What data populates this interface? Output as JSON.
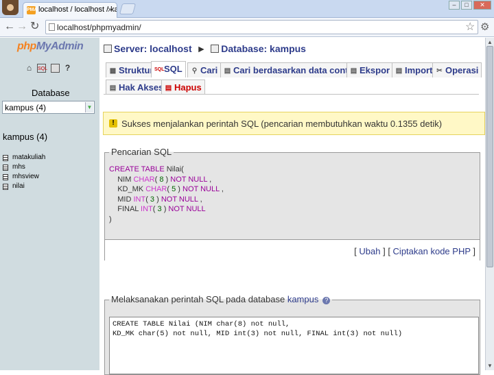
{
  "browser": {
    "tabs": [
      {
        "favicon": "PMA",
        "title": "localhost / localhost / kampus"
      },
      {
        "favicon": "",
        "title": ""
      }
    ],
    "nav": {
      "back": "←",
      "forward": "→",
      "reload": "↻"
    },
    "url": "localhost/phpmyadmin/",
    "window_controls": [
      "–",
      "□",
      "✕"
    ]
  },
  "sidebar": {
    "logo_php": "php",
    "logo_myadmin": "MyAdmin",
    "icons": [
      "home-icon",
      "sql-icon",
      "query-window-icon",
      "docs-icon"
    ],
    "database_label": "Database",
    "database_select_value": "kampus (4)",
    "database_heading": "kampus (4)",
    "tables": [
      "matakuliah",
      "mhs",
      "mhsview",
      "nilai"
    ]
  },
  "main": {
    "breadcrumb": {
      "server": "Server: localhost",
      "separator": "►",
      "database": "Database: kampus"
    },
    "tabs_row1": [
      {
        "label": "Struktur",
        "icon": "structure-icon"
      },
      {
        "label": "SQL",
        "icon": "sql-icon",
        "active": true
      },
      {
        "label": "Cari",
        "icon": "search-icon"
      },
      {
        "label": "Cari berdasarkan data contoh",
        "icon": "query-icon"
      },
      {
        "label": "Ekspor",
        "icon": "export-icon"
      },
      {
        "label": "Import",
        "icon": "import-icon"
      },
      {
        "label": "Operasi",
        "icon": "operations-icon"
      }
    ],
    "tabs_row2": [
      {
        "label": "Hak Akses",
        "icon": "privileges-icon"
      },
      {
        "label": "Hapus",
        "icon": "drop-icon"
      }
    ],
    "notice": "Sukses menjalankan perintah SQL (pencarian membutuhkan waktu 0.1355 detik)",
    "sql_query_box": {
      "legend": "Pencarian SQL",
      "lines": [
        [
          {
            "t": "CREATE TABLE ",
            "c": "kw"
          },
          {
            "t": "Nilai(",
            "c": "plain"
          }
        ],
        [
          {
            "t": "    NIM ",
            "c": "plain"
          },
          {
            "t": "CHAR",
            "c": "fn"
          },
          {
            "t": "( ",
            "c": "plain"
          },
          {
            "t": "8",
            "c": "num"
          },
          {
            "t": " ) ",
            "c": "plain"
          },
          {
            "t": "NOT NULL",
            "c": "kw"
          },
          {
            "t": " ,",
            "c": "plain"
          }
        ],
        [
          {
            "t": "    KD_MK ",
            "c": "plain"
          },
          {
            "t": "CHAR",
            "c": "fn"
          },
          {
            "t": "( ",
            "c": "plain"
          },
          {
            "t": "5",
            "c": "num"
          },
          {
            "t": " ) ",
            "c": "plain"
          },
          {
            "t": "NOT NULL",
            "c": "kw"
          },
          {
            "t": " ,",
            "c": "plain"
          }
        ],
        [
          {
            "t": "    MID ",
            "c": "plain"
          },
          {
            "t": "INT",
            "c": "fn"
          },
          {
            "t": "( ",
            "c": "plain"
          },
          {
            "t": "3",
            "c": "num"
          },
          {
            "t": " ) ",
            "c": "plain"
          },
          {
            "t": "NOT NULL",
            "c": "kw"
          },
          {
            "t": " ,",
            "c": "plain"
          }
        ],
        [
          {
            "t": "    FINAL ",
            "c": "plain"
          },
          {
            "t": "INT",
            "c": "fn"
          },
          {
            "t": "( ",
            "c": "plain"
          },
          {
            "t": "3",
            "c": "num"
          },
          {
            "t": " ) ",
            "c": "plain"
          },
          {
            "t": "NOT NULL",
            "c": "kw"
          }
        ],
        [
          {
            "t": ")",
            "c": "plain"
          }
        ]
      ],
      "actions_open": "[ ",
      "edit_link": "Ubah",
      "actions_mid": " ] [ ",
      "php_link": "Ciptakan kode PHP",
      "actions_close": " ]"
    },
    "run_sql_box": {
      "legend_prefix": "Melaksanakan perintah SQL pada database ",
      "legend_db_link": "kampus",
      "help_icon": "?",
      "textarea_value": "CREATE TABLE Nilai (NIM char(8) not null,\nKD_MK char(5) not null, MID int(3) not null, FINAL int(3) not null)"
    }
  }
}
